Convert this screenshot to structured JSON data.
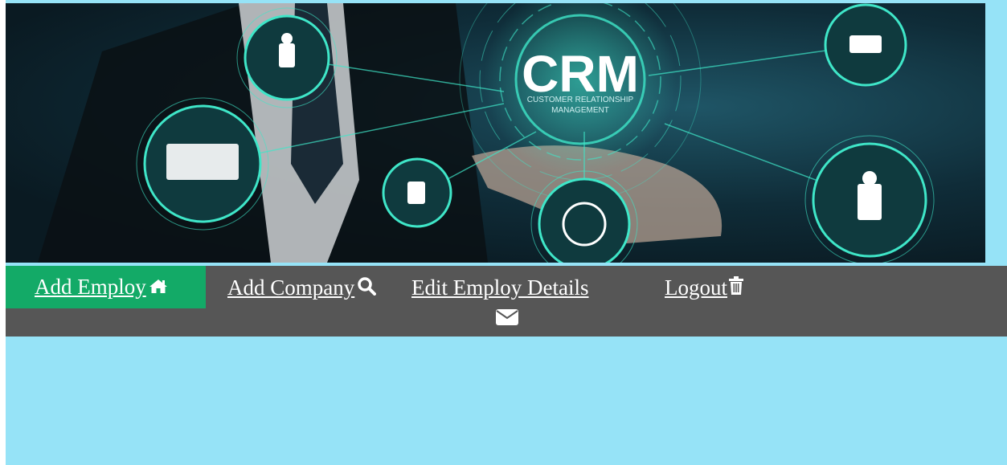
{
  "banner": {
    "title": "CRM",
    "subtitle_line1": "CUSTOMER RELATIONSHIP",
    "subtitle_line2": "MANAGEMENT"
  },
  "nav": {
    "items": [
      {
        "label": "Add Employ",
        "icon": "home-icon",
        "active": true
      },
      {
        "label": "Add Company",
        "icon": "search-icon",
        "active": false
      },
      {
        "label": "Edit Employ Details",
        "icon": "envelope-icon",
        "active": false
      },
      {
        "label": "Logout",
        "icon": "trash-icon",
        "active": false
      }
    ]
  },
  "colors": {
    "page_background": "#96e3f7",
    "nav_background": "#565656",
    "nav_active": "#13aa67",
    "banner_accent": "#3fe6c8"
  }
}
